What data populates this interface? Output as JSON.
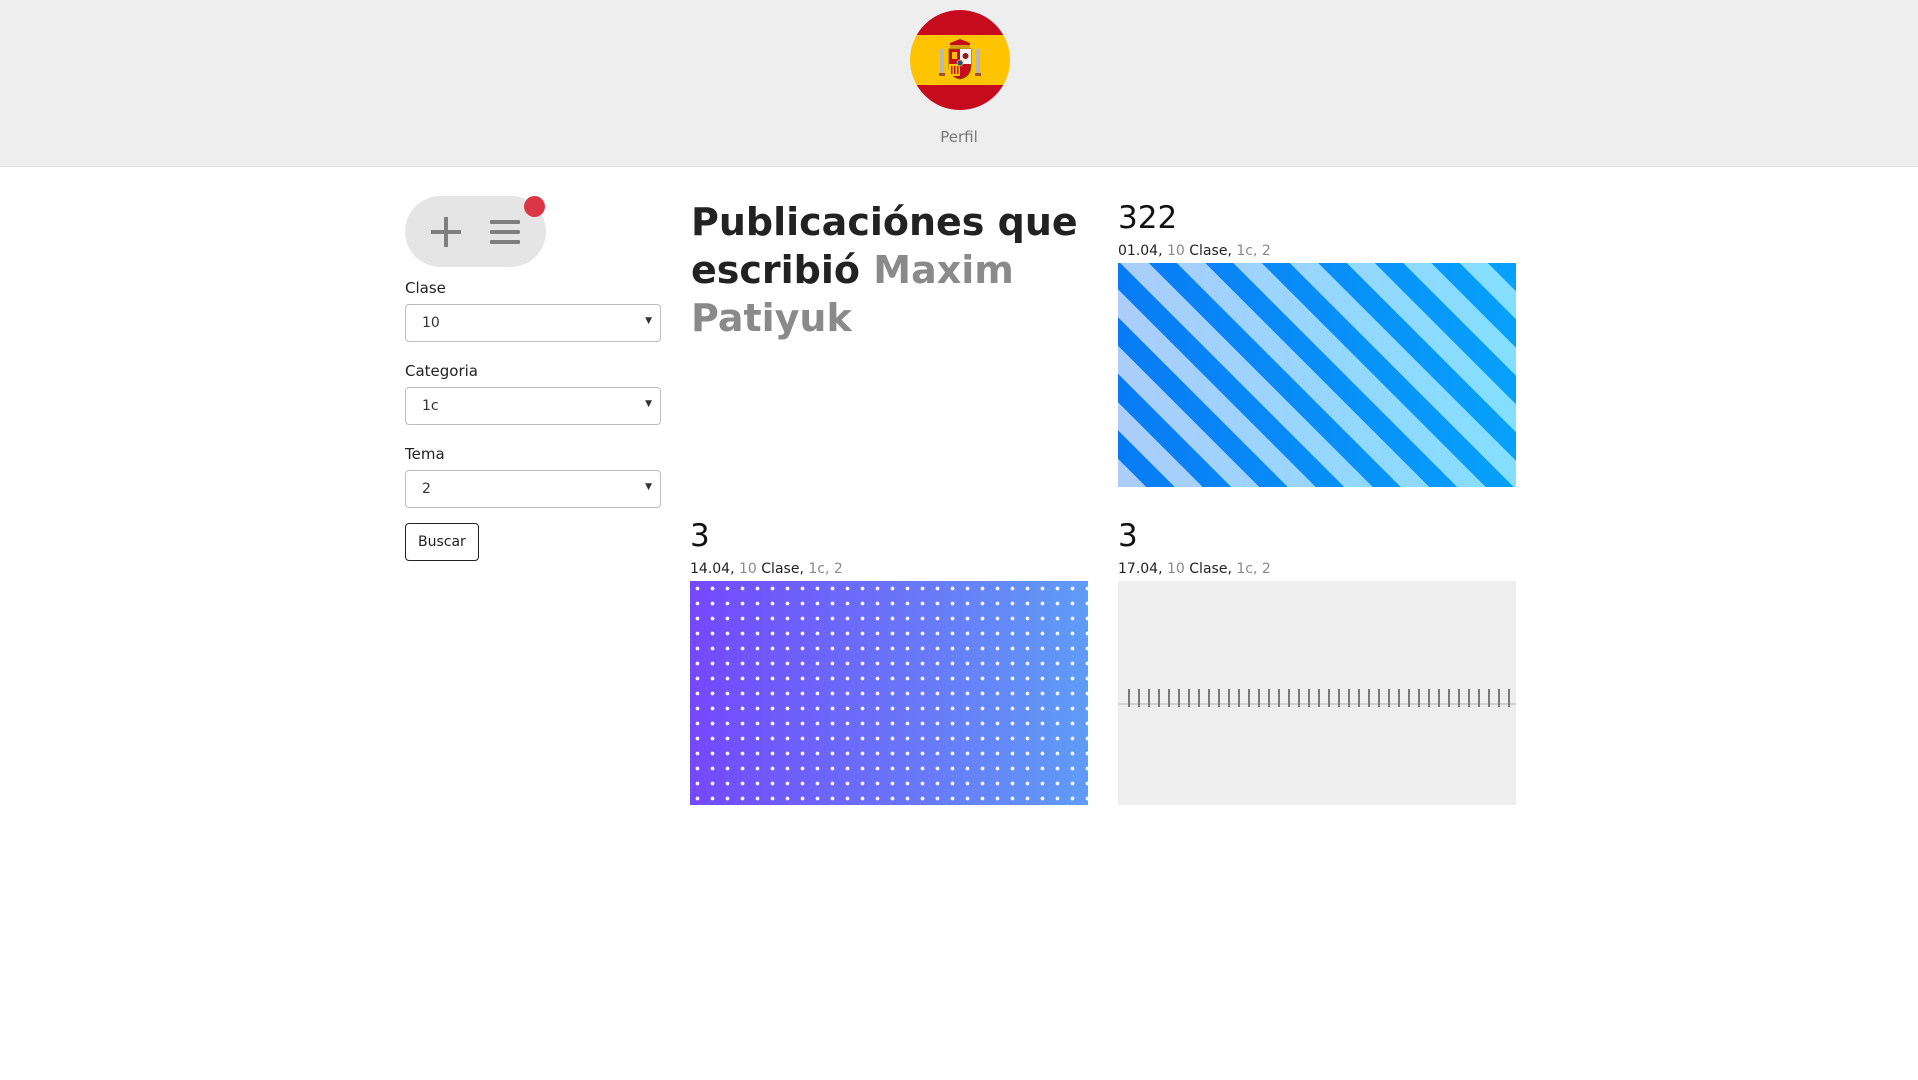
{
  "header": {
    "profile_label": "Perfil"
  },
  "colors": {
    "accent_red": "#dc3545",
    "header_bg": "#eeeeee",
    "muted_text": "#8a8a8a"
  },
  "icons": {
    "add": "plus-icon",
    "menu": "hamburger-menu-icon",
    "avatar": "spain-flag-icon"
  },
  "filters": {
    "clase": {
      "label": "Clase",
      "value": "10"
    },
    "categoria": {
      "label": "Categoria",
      "value": "1c"
    },
    "tema": {
      "label": "Tema",
      "value": "2"
    },
    "search_label": "Buscar"
  },
  "main": {
    "heading_prefix": "Publicaciónes que escribió",
    "heading_author": "Maxim Patiyuk"
  },
  "posts": [
    {
      "title": "322",
      "date": "01.04",
      "clase_num": "10",
      "clase_word": "Clase",
      "categoria": "1c",
      "tema": "2",
      "image": "blue-diagonal-stripes"
    },
    {
      "title": "3",
      "date": "14.04",
      "clase_num": "10",
      "clase_word": "Clase",
      "categoria": "1c",
      "tema": "2",
      "image": "purple-dot-grid"
    },
    {
      "title": "3",
      "date": "17.04",
      "clase_num": "10",
      "clase_word": "Clase",
      "categoria": "1c",
      "tema": "2",
      "image": "notebook-spiral"
    }
  ],
  "sep": ", "
}
